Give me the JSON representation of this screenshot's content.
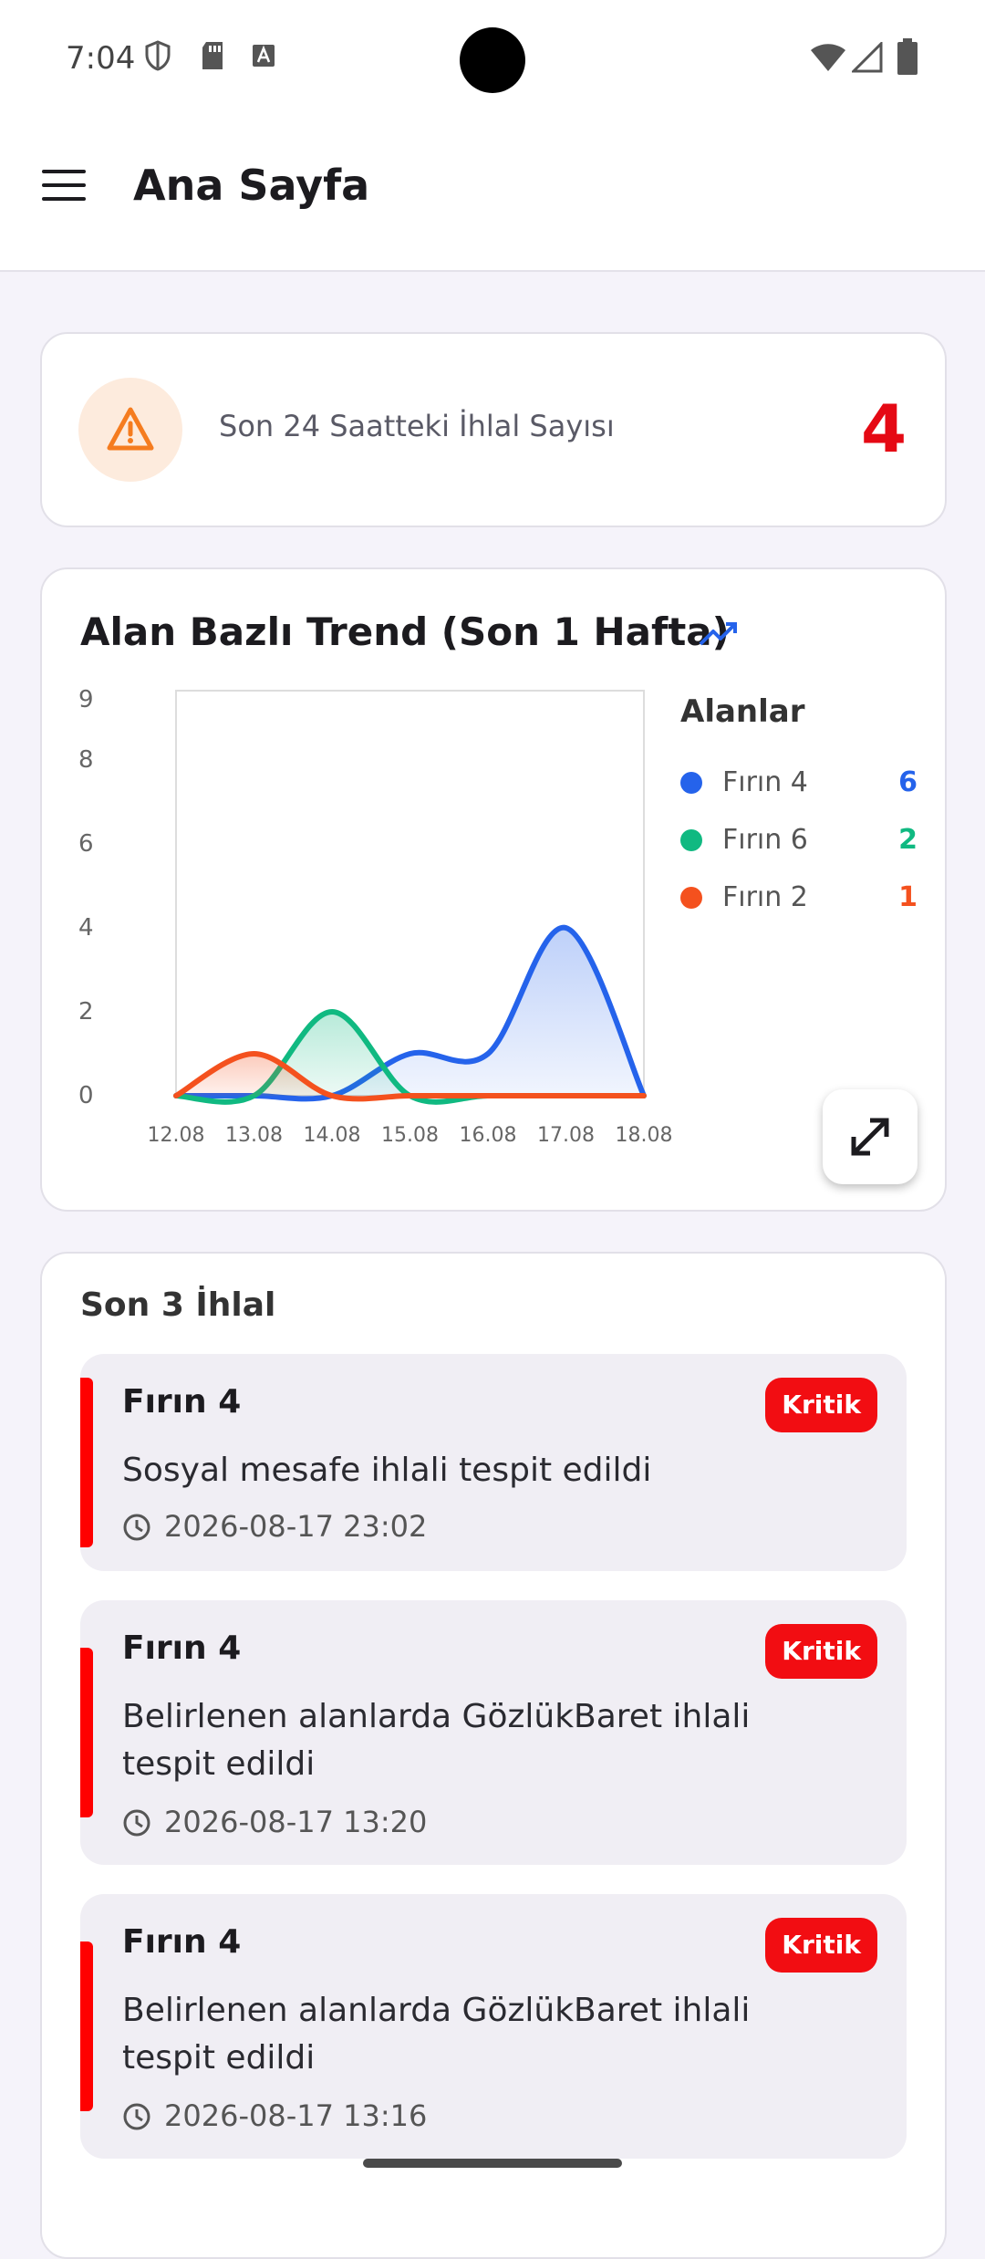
{
  "status_bar": {
    "time": "7:04"
  },
  "app_bar": {
    "title": "Ana Sayfa"
  },
  "summary": {
    "label": "Son 24 Saatteki İhlal Sayısı",
    "count": "4",
    "icon": "warning-triangle-icon"
  },
  "trend": {
    "title": "Alan Bazlı Trend (Son 1 Hafta)",
    "legend_title": "Alanlar",
    "legend": [
      {
        "name": "Fırın 4",
        "value": "6",
        "color": "#2563EB"
      },
      {
        "name": "Fırın 6",
        "value": "2",
        "color": "#10B981"
      },
      {
        "name": "Fırın 2",
        "value": "1",
        "color": "#F4511E"
      }
    ]
  },
  "chart_data": {
    "type": "area",
    "categories": [
      "12.08",
      "13.08",
      "14.08",
      "15.08",
      "16.08",
      "17.08",
      "18.08"
    ],
    "y_ticks": [
      "9",
      "8",
      "6",
      "4",
      "2",
      "0"
    ],
    "ylim": [
      0,
      9
    ],
    "series": [
      {
        "name": "Fırın 4",
        "color": "#2563EB",
        "values": [
          0,
          0,
          0,
          1,
          1,
          4,
          0
        ]
      },
      {
        "name": "Fırın 6",
        "color": "#10B981",
        "values": [
          0,
          0,
          2,
          0,
          0,
          0,
          0
        ]
      },
      {
        "name": "Fırın 2",
        "color": "#F4511E",
        "values": [
          0,
          1,
          0,
          0,
          0,
          0,
          0
        ]
      }
    ]
  },
  "recent": {
    "title": "Son 3 İhlal",
    "items": [
      {
        "area": "Fırın 4",
        "badge": "Kritik",
        "message": "Sosyal mesafe ihlali tespit edildi",
        "time": "2026-08-17 23:02"
      },
      {
        "area": "Fırın 4",
        "badge": "Kritik",
        "message": "Belirlenen alanlarda GözlükBaret ihlali tespit edildi",
        "time": "2026-08-17 13:20"
      },
      {
        "area": "Fırın 4",
        "badge": "Kritik",
        "message": "Belirlenen alanlarda GözlükBaret ihlali tespit edildi",
        "time": "2026-08-17 13:16"
      }
    ]
  }
}
